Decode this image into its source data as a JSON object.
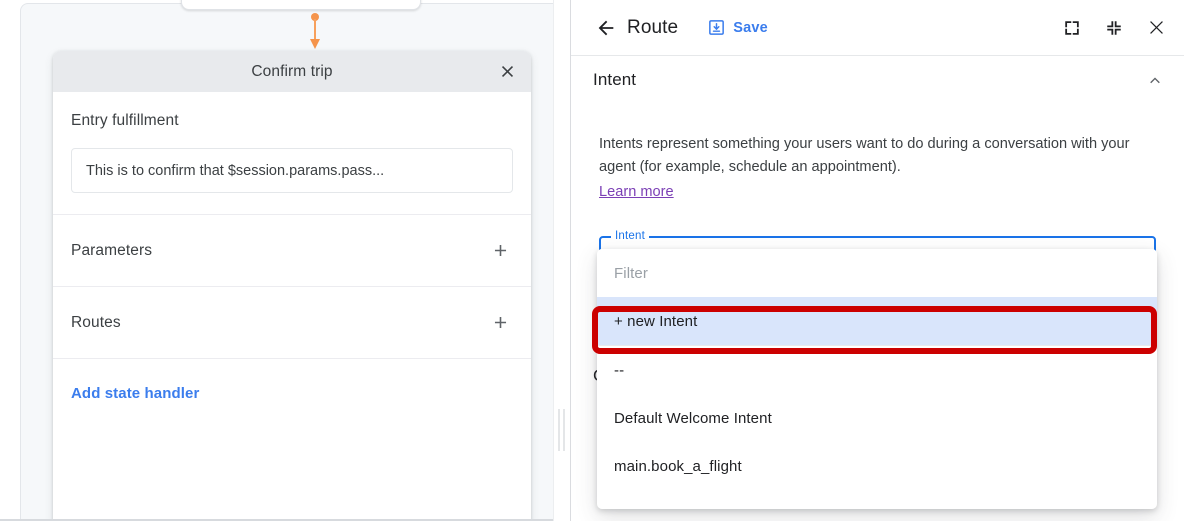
{
  "flow_canvas": {
    "connector_color": "#f5944b",
    "upstream_node_hint": "",
    "page_card": {
      "title": "Confirm trip",
      "close_icon": "close-icon",
      "entry_fulfillment": {
        "label": "Entry fulfillment",
        "value": "This is to confirm that $session.params.pass..."
      },
      "sections": [
        {
          "label": "Parameters",
          "add_icon": "plus-icon"
        },
        {
          "label": "Routes",
          "add_icon": "plus-icon"
        }
      ],
      "add_state_handler_label": "Add state handler",
      "link_color": "#3b7ded"
    }
  },
  "side_panel": {
    "header": {
      "back_icon": "arrow-left-icon",
      "title": "Route",
      "save_label": "Save",
      "save_icon": "save-icon",
      "save_color": "#3b7ded",
      "actions": [
        {
          "name": "expand-icon"
        },
        {
          "name": "collapse-icon"
        },
        {
          "name": "close-icon"
        }
      ]
    },
    "intent_section": {
      "title": "Intent",
      "chevron": "chevron-up-icon",
      "description": "Intents represent something your users want to do during a conversation with your agent (for example, schedule an appointment).",
      "learn_more_label": "Learn more",
      "learn_more_color": "#7b3fb5",
      "field": {
        "floating_label": "Intent",
        "value": "",
        "focus_color": "#1a73e8"
      }
    },
    "behind_section": {
      "title_stub": "C",
      "chevron": "chevron-down-icon"
    },
    "intent_dropdown": {
      "filter_placeholder": "Filter",
      "options": [
        {
          "label": "+ new Intent",
          "selected": true
        },
        {
          "label": "--",
          "selected": false
        },
        {
          "label": "Default Welcome Intent",
          "selected": false
        },
        {
          "label": "main.book_a_flight",
          "selected": false
        }
      ],
      "selected_bg": "#d9e5fb"
    }
  },
  "annotation": {
    "color": "#cc0000",
    "target": "+ new Intent"
  }
}
